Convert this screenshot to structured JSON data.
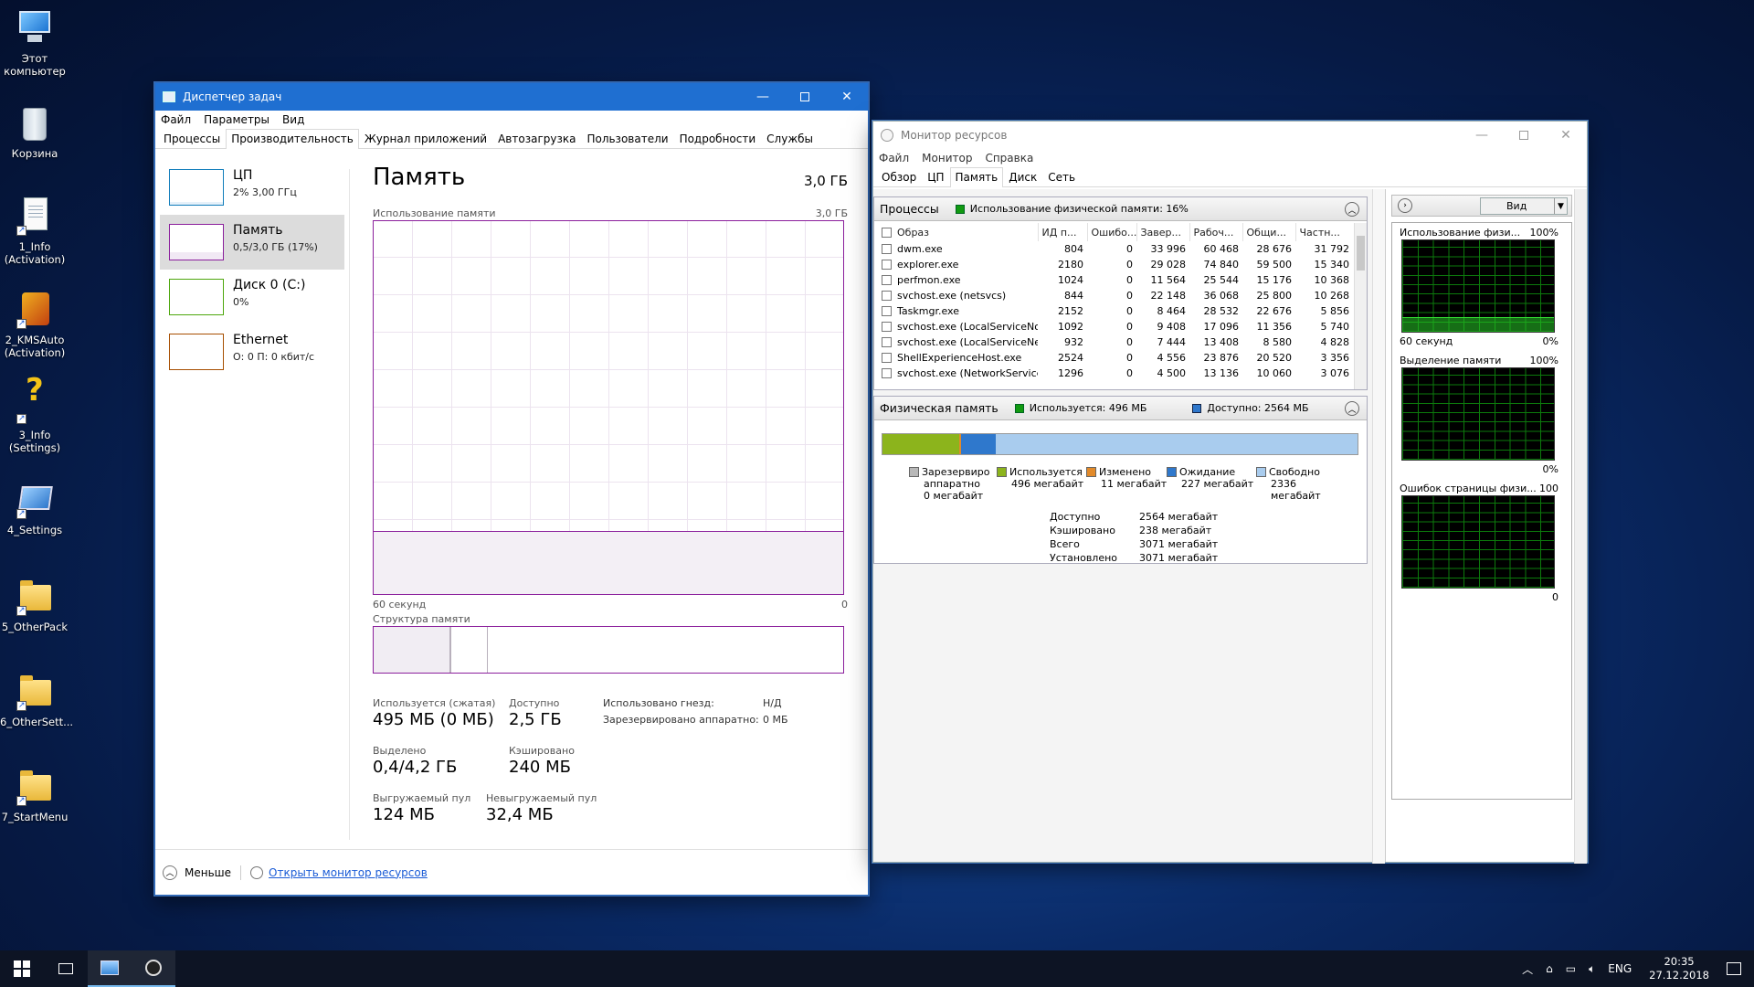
{
  "desktop": {
    "icons": [
      {
        "label": "Этот компьютер",
        "kind": "pc"
      },
      {
        "label": "Корзина",
        "kind": "bin"
      },
      {
        "label": "1_Info (Activation)",
        "kind": "doc"
      },
      {
        "label": "2_KMSAuto (Activation)",
        "kind": "kms"
      },
      {
        "label": "3_Info (Settings)",
        "kind": "q"
      },
      {
        "label": "4_Settings",
        "kind": "set"
      },
      {
        "label": "5_OtherPack",
        "kind": "fold"
      },
      {
        "label": "6_OtherSett...",
        "kind": "fold"
      },
      {
        "label": "7_StartMenu",
        "kind": "fold"
      }
    ]
  },
  "taskmanager": {
    "title": "Диспетчер задач",
    "menu": [
      "Файл",
      "Параметры",
      "Вид"
    ],
    "tabs": [
      "Процессы",
      "Производительность",
      "Журнал приложений",
      "Автозагрузка",
      "Пользователи",
      "Подробности",
      "Службы"
    ],
    "active_tab": 1,
    "left_items": [
      {
        "name": "ЦП",
        "sub": "2% 3,00 ГГц",
        "color": "#117dbb"
      },
      {
        "name": "Память",
        "sub": "0,5/3,0 ГБ (17%)",
        "color": "#8b1f9c"
      },
      {
        "name": "Диск 0 (C:)",
        "sub": "0%",
        "color": "#4da60c"
      },
      {
        "name": "Ethernet",
        "sub": "О: 0 П: 0 кбит/с",
        "color": "#a74f01"
      }
    ],
    "right": {
      "heading": "Память",
      "capacity": "3,0 ГБ",
      "usage_label": "Использование памяти",
      "usage_max": "3,0 ГБ",
      "usage_fraction": 0.17,
      "graph_left": "60 секунд",
      "graph_right": "0",
      "structure_label": "Структура памяти",
      "stats": {
        "in_use_label": "Используется (сжатая)",
        "in_use_value": "495 МБ (0 МБ)",
        "available_label": "Доступно",
        "available_value": "2,5 ГБ",
        "committed_label": "Выделено",
        "committed_value": "0,4/4,2 ГБ",
        "cached_label": "Кэшировано",
        "cached_value": "240 МБ",
        "paged_label": "Выгружаемый пул",
        "paged_value": "124 МБ",
        "nonpaged_label": "Невыгружаемый пул",
        "nonpaged_value": "32,4 МБ",
        "slots_label": "Использовано гнезд:",
        "slots_value": "Н/Д",
        "reserved_label": "Зарезервировано аппаратно:",
        "reserved_value": "0 МБ"
      }
    },
    "footer": {
      "less": "Меньше",
      "open_monitor": "Открыть монитор ресурсов"
    }
  },
  "resmon": {
    "title": "Монитор ресурсов",
    "menu": [
      "Файл",
      "Монитор",
      "Справка"
    ],
    "tabs": [
      "Обзор",
      "ЦП",
      "Память",
      "Диск",
      "Сеть"
    ],
    "active_tab": 2,
    "processes": {
      "title": "Процессы",
      "indicator": "Использование физической памяти: 16%",
      "columns": [
        "Образ",
        "ИД п...",
        "Ошибо...",
        "Завер...",
        "Рабоч...",
        "Общи...",
        "Частн..."
      ],
      "rows": [
        [
          "dwm.exe",
          "804",
          "0",
          "33 996",
          "60 468",
          "28 676",
          "31 792"
        ],
        [
          "explorer.exe",
          "2180",
          "0",
          "29 028",
          "74 840",
          "59 500",
          "15 340"
        ],
        [
          "perfmon.exe",
          "1024",
          "0",
          "11 564",
          "25 544",
          "15 176",
          "10 368"
        ],
        [
          "svchost.exe (netsvcs)",
          "844",
          "0",
          "22 148",
          "36 068",
          "25 800",
          "10 268"
        ],
        [
          "Taskmgr.exe",
          "2152",
          "0",
          "8 464",
          "28 532",
          "22 676",
          "5 856"
        ],
        [
          "svchost.exe (LocalServiceNo...",
          "1092",
          "0",
          "9 408",
          "17 096",
          "11 356",
          "5 740"
        ],
        [
          "svchost.exe (LocalServiceNet...",
          "932",
          "0",
          "7 444",
          "13 408",
          "8 580",
          "4 828"
        ],
        [
          "ShellExperienceHost.exe",
          "2524",
          "0",
          "4 556",
          "23 876",
          "20 520",
          "3 356"
        ],
        [
          "svchost.exe (NetworkService)",
          "1296",
          "0",
          "4 500",
          "13 136",
          "10 060",
          "3 076"
        ]
      ]
    },
    "physical": {
      "title": "Физическая память",
      "used_indicator": "Используется: 496 МБ",
      "avail_indicator": "Доступно: 2564 МБ",
      "strip": [
        {
          "name": "reserved",
          "mb": 0,
          "color": "#b8b8b8"
        },
        {
          "name": "used",
          "mb": 496,
          "color": "#8cb41c"
        },
        {
          "name": "modified",
          "mb": 11,
          "color": "#e28a2a"
        },
        {
          "name": "standby",
          "mb": 227,
          "color": "#2f78cc"
        },
        {
          "name": "free",
          "mb": 2336,
          "color": "#a9ccee"
        }
      ],
      "legend": [
        {
          "title": "Зарезервиро",
          "lines": [
            "аппаратно",
            "0 мегабайт"
          ],
          "color": "#b8b8b8"
        },
        {
          "title": "Используется",
          "lines": [
            "496 мегабайт"
          ],
          "color": "#8cb41c"
        },
        {
          "title": "Изменено",
          "lines": [
            "11 мегабайт"
          ],
          "color": "#e28a2a"
        },
        {
          "title": "Ожидание",
          "lines": [
            "227 мегабайт"
          ],
          "color": "#2f78cc"
        },
        {
          "title": "Свободно",
          "lines": [
            "2336",
            "мегабайт"
          ],
          "color": "#a9ccee"
        }
      ],
      "stats": [
        [
          "Доступно",
          "2564 мегабайт"
        ],
        [
          "Кэшировано",
          "238 мегабайт"
        ],
        [
          "Всего",
          "3071 мегабайт"
        ],
        [
          "Установлено",
          "3071 мегабайт"
        ]
      ]
    },
    "side": {
      "view_label": "Вид",
      "graphs": [
        {
          "title": "Использование физи...",
          "max": "100%",
          "left": "60 секунд",
          "right": "0%",
          "level": 0.16
        },
        {
          "title": "Выделение памяти",
          "max": "100%",
          "left": "",
          "right": "0%",
          "level": 0.0
        },
        {
          "title": "Ошибок страницы физи...",
          "max": "100",
          "left": "",
          "right": "0",
          "level": 0.0
        }
      ]
    }
  },
  "taskbar": {
    "lang": "ENG",
    "time": "20:35",
    "date": "27.12.2018"
  }
}
